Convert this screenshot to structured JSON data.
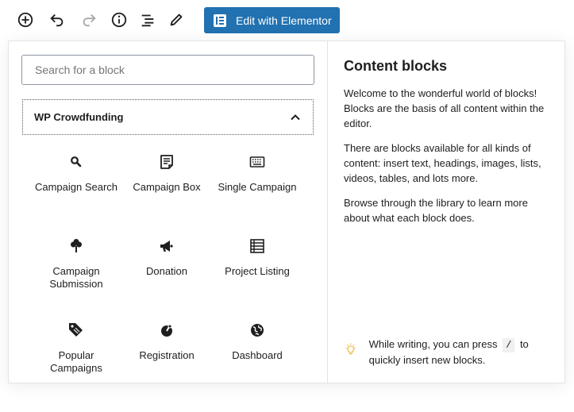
{
  "toolbar": {
    "add_icon": "plus-circle-icon",
    "undo_icon": "undo-icon",
    "redo_icon": "redo-icon",
    "info_icon": "info-icon",
    "outline_icon": "list-view-icon",
    "edit_icon": "pencil-icon",
    "elementor_label": "Edit with Elementor"
  },
  "inserter": {
    "search_placeholder": "Search for a block",
    "category": {
      "label": "WP Crowdfunding",
      "expanded": true
    },
    "blocks": [
      {
        "label": "Campaign Search",
        "icon": "search-icon"
      },
      {
        "label": "Campaign Box",
        "icon": "campaign-box-icon"
      },
      {
        "label": "Single Campaign",
        "icon": "keyboard-icon"
      },
      {
        "label": "Campaign Submission",
        "icon": "submission-icon"
      },
      {
        "label": "Donation",
        "icon": "megaphone-icon"
      },
      {
        "label": "Project Listing",
        "icon": "project-listing-icon"
      },
      {
        "label": "Popular Campaigns",
        "icon": "tag-icon"
      },
      {
        "label": "Registration",
        "icon": "registration-icon"
      },
      {
        "label": "Dashboard",
        "icon": "globe-icon"
      }
    ]
  },
  "help": {
    "title": "Content blocks",
    "paragraphs": [
      "Welcome to the wonderful world of blocks! Blocks are the basis of all content within the editor.",
      "There are blocks available for all kinds of content: insert text, headings, images, lists, videos, tables, and lots more.",
      "Browse through the library to learn more about what each block does."
    ],
    "tip": {
      "icon": "lightbulb-icon",
      "before": "While writing, you can press",
      "key": "/",
      "after": "to quickly insert new blocks."
    }
  },
  "colors": {
    "accent": "#2271b1",
    "tip_icon": "#f0b849",
    "icon_dark": "#1e1e1e",
    "icon_disabled": "#a7aaad"
  }
}
